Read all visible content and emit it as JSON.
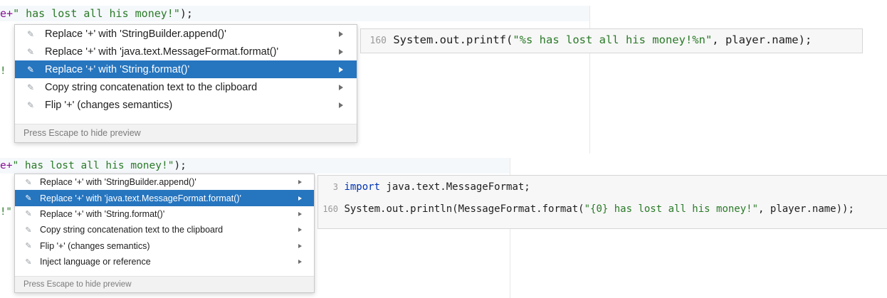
{
  "top_example": {
    "editor_line": {
      "prefix": "e+",
      "string": "\" has lost all his money!\"",
      "suffix": ");"
    },
    "gutter_fragment": "!",
    "menu": {
      "items": [
        {
          "label": "Replace '+' with 'StringBuilder.append()'",
          "selected": false
        },
        {
          "label": "Replace '+' with 'java.text.MessageFormat.format()'",
          "selected": false
        },
        {
          "label": "Replace '+' with 'String.format()'",
          "selected": true
        },
        {
          "label": "Copy string concatenation text to the clipboard",
          "selected": false
        },
        {
          "label": "Flip '+' (changes semantics)",
          "selected": false
        }
      ],
      "footer": "Press Escape to hide preview"
    },
    "preview": {
      "line_number": "160",
      "code_prefix": "System.out.printf(",
      "code_string": "\"%s has lost all his money!%n\"",
      "code_suffix": ", player.name);"
    }
  },
  "bottom_example": {
    "editor_line": {
      "prefix": "e+",
      "string": "\" has lost all his money!\"",
      "suffix": ");"
    },
    "gutter_fragment": "!\"",
    "menu": {
      "items": [
        {
          "label": "Replace '+' with 'StringBuilder.append()'",
          "selected": false
        },
        {
          "label": "Replace '+' with 'java.text.MessageFormat.format()'",
          "selected": true
        },
        {
          "label": "Replace '+' with 'String.format()'",
          "selected": false
        },
        {
          "label": "Copy string concatenation text to the clipboard",
          "selected": false
        },
        {
          "label": "Flip '+' (changes semantics)",
          "selected": false
        },
        {
          "label": "Inject language or reference",
          "selected": false
        }
      ],
      "footer": "Press Escape to hide preview"
    },
    "preview": {
      "import_line_number": "3",
      "import_keyword": "import",
      "import_rest": " java.text.MessageFormat;",
      "line_number": "160",
      "code_prefix": "System.out.println(MessageFormat.format(",
      "code_string": "\"{0} has lost all his money!\"",
      "code_suffix": ", player.name));"
    }
  },
  "icons": {
    "intention": "bulb-edit-icon",
    "submenu": "chevron-right-icon"
  },
  "colors": {
    "selection": "#2675bf",
    "string": "#2a7a28",
    "keyword": "#0033b3",
    "line_number": "#9a9a9a"
  }
}
